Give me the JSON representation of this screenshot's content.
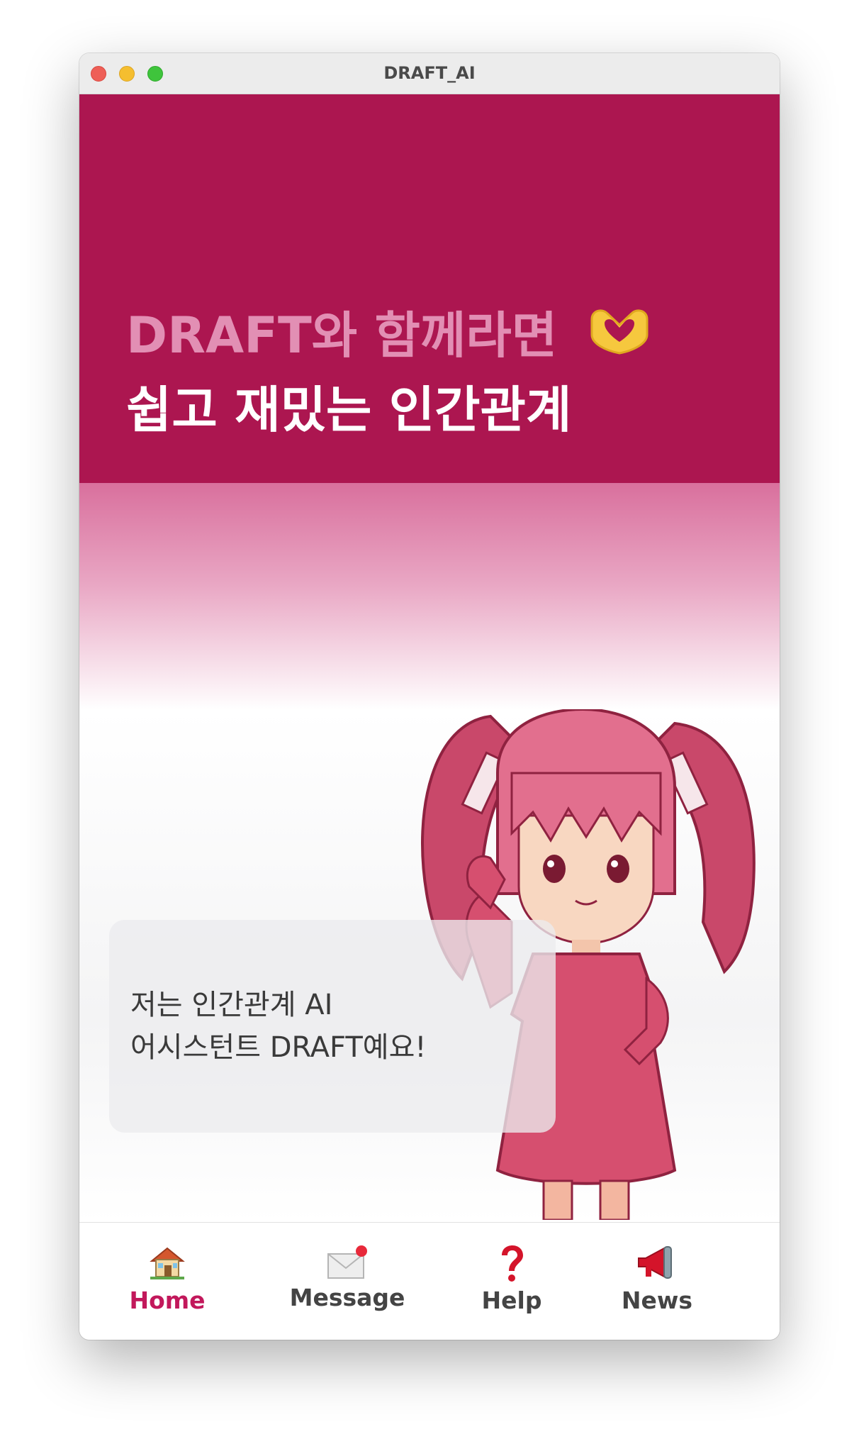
{
  "window": {
    "title": "DRAFT_AI"
  },
  "hero": {
    "line1": "DRAFT와 함께라면",
    "line2": "쉽고 재밌는 인간관계",
    "line1_icon": "heart-hands-icon"
  },
  "assistant": {
    "message_line1": "저는 인간관계 AI",
    "message_line2": "어시스턴트 DRAFT예요!"
  },
  "tabbar": {
    "items": [
      {
        "label": "Home",
        "icon": "house-icon",
        "active": true
      },
      {
        "label": "Message",
        "icon": "envelope-icon",
        "active": false,
        "has_badge": true
      },
      {
        "label": "Help",
        "icon": "question-mark-icon",
        "active": false
      },
      {
        "label": "News",
        "icon": "megaphone-icon",
        "active": false
      }
    ]
  },
  "colors": {
    "hero_background": "#ac1650",
    "hero_line1": "#e28fb4",
    "hero_line2": "#ffffff",
    "active_tab": "#c2185b",
    "inactive_tab": "#444444"
  }
}
